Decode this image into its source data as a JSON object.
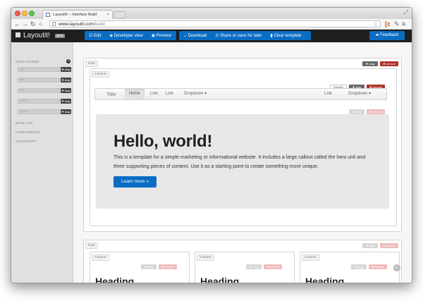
{
  "browser": {
    "tab_title": "LayoutIt! – Interface Build",
    "url_host": "www.layoutit.com",
    "url_path": "/build",
    "tab_close": "×"
  },
  "appbar": {
    "brand": "Layoutit!",
    "beta": "BETA",
    "buttons": [
      "Edit",
      "Developer view",
      "Preview"
    ],
    "actions": [
      "Download",
      "Share or save for later",
      "Clear template"
    ],
    "feedback": "Feedback"
  },
  "sidebar": {
    "grid_system": "GRID SYSTEM",
    "help": "?",
    "grid_rows": [
      "12",
      "6 6",
      "8 4",
      "4 4 4",
      "2 6 4"
    ],
    "drag_label": "drag",
    "sections": [
      "BASE CSS",
      "COMPONENTS",
      "JAVASCRIPT"
    ]
  },
  "canvas": {
    "row_label": "Row",
    "column_label": "Column",
    "drag": "drag",
    "remove": "remove",
    "inverse": "Inverse",
    "navbar": {
      "title": "Title",
      "left_items": [
        "Home",
        "Link",
        "Link",
        "Dropdown ▾"
      ],
      "right_items": [
        "Link",
        "Dropdown ▾"
      ]
    },
    "hero": {
      "heading": "Hello, world!",
      "text": "This is a template for a simple marketing or informational website. It includes a large callout called the hero unit and three supporting pieces of content. Use it as a starting point to create something more unique.",
      "button": "Learn more »"
    },
    "columns_heading": "Heading"
  },
  "colors": {
    "accent_blue": "#0a6dc4",
    "danger_red": "#b0302b",
    "appbar_bg": "#1f1f1f"
  }
}
